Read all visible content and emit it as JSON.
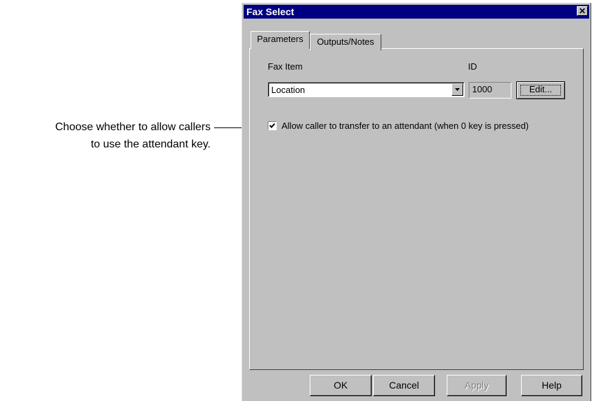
{
  "callout": {
    "line1": "Choose whether to allow callers",
    "line2": "to use the attendant key."
  },
  "window": {
    "title": "Fax Select",
    "close_glyph": "✕"
  },
  "tabs": [
    {
      "label": "Parameters",
      "active": true
    },
    {
      "label": "Outputs/Notes",
      "active": false
    }
  ],
  "form": {
    "fax_item_label": "Fax Item",
    "id_label": "ID",
    "fax_item_value": "Location",
    "id_value": "1000",
    "edit_label": "Edit...",
    "allow_transfer_label": "Allow caller to transfer to an attendant (when 0 key is pressed)",
    "allow_transfer_checked": true
  },
  "buttons": {
    "ok": "OK",
    "cancel": "Cancel",
    "apply": "Apply",
    "help": "Help"
  },
  "colors": {
    "titlebar": "#000080",
    "face": "#c0c0c0",
    "disabled_text": "#808080"
  }
}
